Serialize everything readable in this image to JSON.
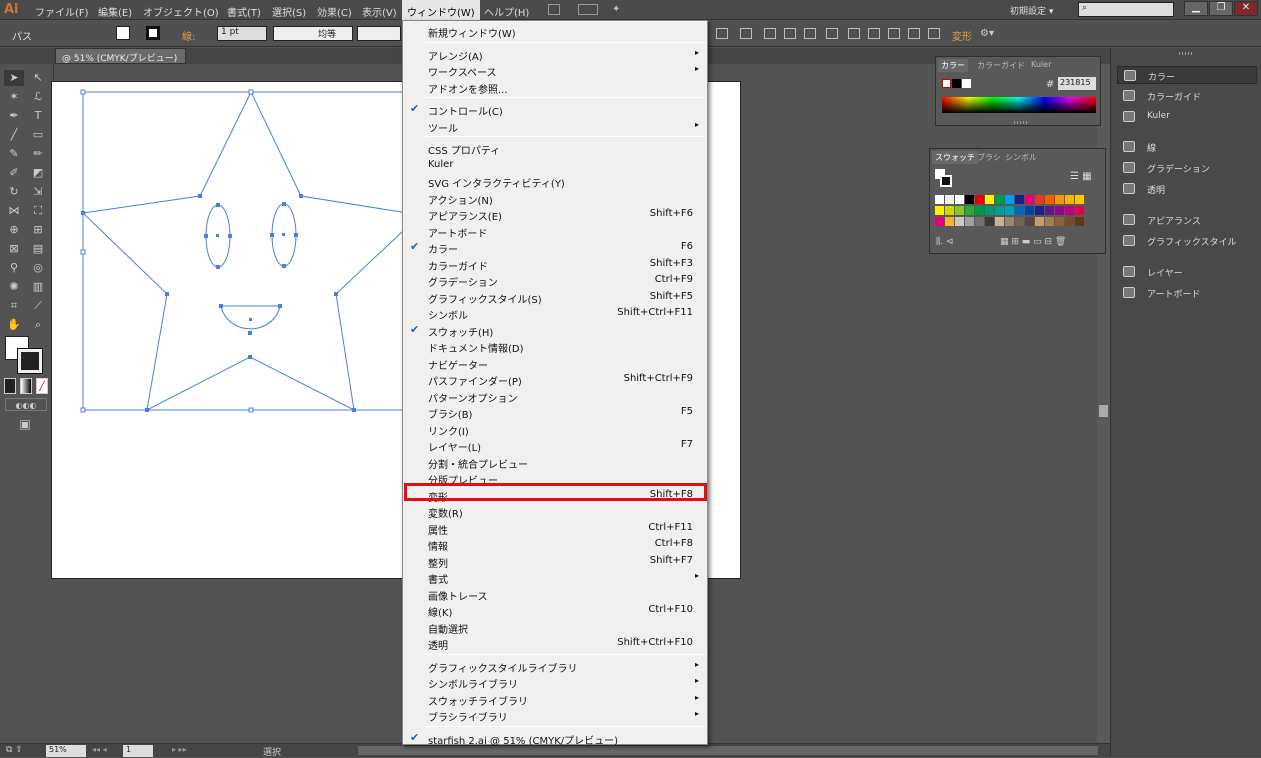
{
  "app": {
    "logo": "Ai"
  },
  "menubar": {
    "items": [
      "ファイル(F)",
      "編集(E)",
      "オブジェクト(O)",
      "書式(T)",
      "選択(S)",
      "効果(C)",
      "表示(V)",
      "ウィンドウ(W)",
      "ヘルプ(H)"
    ],
    "workspace": "初期設定 ▾",
    "search_placeholder": "",
    "min": "▁",
    "restore": "❐",
    "close": "✕"
  },
  "control": {
    "selection_label": "パス",
    "stroke_label": "線:",
    "stroke_weight": "1 pt",
    "profile": "均等",
    "transform_label": "変形"
  },
  "document": {
    "tab_title": "@ 51% (CMYK/プレビュー)"
  },
  "status": {
    "zoom": "51%",
    "page": "1",
    "mode": "選択"
  },
  "color_panel": {
    "tabs": [
      "カラー",
      "カラーガイド",
      "Kuler"
    ],
    "hex_label": "#",
    "hex": "231815"
  },
  "swatch_panel": {
    "tabs": [
      "スウォッチ",
      "ブラシ",
      "シンボル"
    ]
  },
  "dock": {
    "items": [
      "カラー",
      "カラーガイド",
      "Kuler",
      "線",
      "グラデーション",
      "透明",
      "アピアランス",
      "グラフィックスタイル",
      "レイヤー",
      "アートボード"
    ]
  },
  "window_menu": {
    "items": [
      {
        "label": "新規ウィンドウ(W)"
      },
      {
        "sep": true
      },
      {
        "label": "アレンジ(A)",
        "sub": true
      },
      {
        "label": "ワークスペース",
        "sub": true
      },
      {
        "label": "アドオンを参照..."
      },
      {
        "sep": true
      },
      {
        "label": "コントロール(C)",
        "check": true
      },
      {
        "label": "ツール",
        "sub": true
      },
      {
        "sep": true
      },
      {
        "label": "CSS プロパティ"
      },
      {
        "label": "Kuler"
      },
      {
        "label": "SVG インタラクティビティ(Y)"
      },
      {
        "label": "アクション(N)"
      },
      {
        "label": "アピアランス(E)",
        "shortcut": "Shift+F6"
      },
      {
        "label": "アートボード"
      },
      {
        "label": "カラー",
        "shortcut": "F6",
        "check": true
      },
      {
        "label": "カラーガイド",
        "shortcut": "Shift+F3"
      },
      {
        "label": "グラデーション",
        "shortcut": "Ctrl+F9"
      },
      {
        "label": "グラフィックスタイル(S)",
        "shortcut": "Shift+F5"
      },
      {
        "label": "シンボル",
        "shortcut": "Shift+Ctrl+F11"
      },
      {
        "label": "スウォッチ(H)",
        "check": true
      },
      {
        "label": "ドキュメント情報(D)"
      },
      {
        "label": "ナビゲーター"
      },
      {
        "label": "パスファインダー(P)",
        "shortcut": "Shift+Ctrl+F9"
      },
      {
        "label": "パターンオプション"
      },
      {
        "label": "ブラシ(B)",
        "shortcut": "F5"
      },
      {
        "label": "リンク(I)"
      },
      {
        "label": "レイヤー(L)",
        "shortcut": "F7"
      },
      {
        "label": "分割・統合プレビュー"
      },
      {
        "label": "分版プレビュー"
      },
      {
        "label": "変形",
        "shortcut": "Shift+F8",
        "highlight": true
      },
      {
        "label": "変数(R)"
      },
      {
        "label": "属性",
        "shortcut": "Ctrl+F11"
      },
      {
        "label": "情報",
        "shortcut": "Ctrl+F8"
      },
      {
        "label": "整列",
        "shortcut": "Shift+F7"
      },
      {
        "label": "書式",
        "sub": true
      },
      {
        "label": "画像トレース"
      },
      {
        "label": "線(K)",
        "shortcut": "Ctrl+F10"
      },
      {
        "label": "自動選択"
      },
      {
        "label": "透明",
        "shortcut": "Shift+Ctrl+F10"
      },
      {
        "sep": true
      },
      {
        "label": "グラフィックスタイルライブラリ",
        "sub": true
      },
      {
        "label": "シンボルライブラリ",
        "sub": true
      },
      {
        "label": "スウォッチライブラリ",
        "sub": true
      },
      {
        "label": "ブラシライブラリ",
        "sub": true
      },
      {
        "sep": true
      },
      {
        "label": "starfish 2.ai @ 51% (CMYK/プレビュー)",
        "check": true
      }
    ]
  },
  "colors": {
    "accent_check": "#1a5fc4",
    "highlight_box": "#e01010",
    "path_blue": "#4a7fe0"
  }
}
